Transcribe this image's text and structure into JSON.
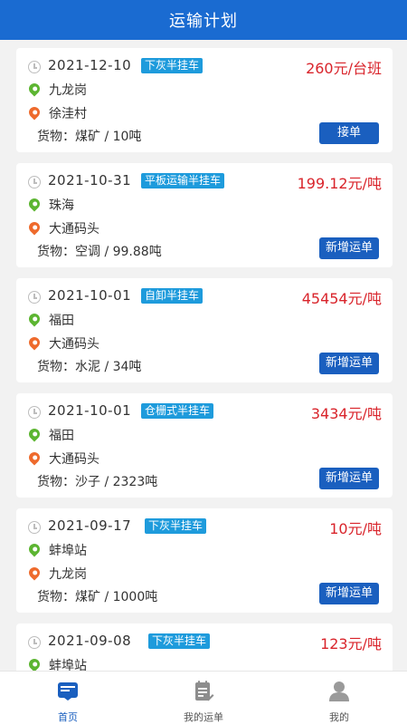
{
  "header": {
    "title": "运输计划"
  },
  "orders": [
    {
      "date": "2021-12-10",
      "vehicle_type": "下灰半挂车",
      "price": "260元/台班",
      "origin": "九龙岗",
      "destination": "徐洼村",
      "cargo": "货物：煤矿 / 10吨",
      "action": "接单"
    },
    {
      "date": "2021-10-31",
      "vehicle_type": "平板运输半挂车",
      "price": "199.12元/吨",
      "origin": "珠海",
      "destination": "大通码头",
      "cargo": "货物：空调 / 99.88吨",
      "action": "新增运单"
    },
    {
      "date": "2021-10-01",
      "vehicle_type": "自卸半挂车",
      "price": "45454元/吨",
      "origin": "福田",
      "destination": "大通码头",
      "cargo": "货物：水泥 / 34吨",
      "action": "新增运单"
    },
    {
      "date": "2021-10-01",
      "vehicle_type": "仓栅式半挂车",
      "price": "3434元/吨",
      "origin": "福田",
      "destination": "大通码头",
      "cargo": "货物：沙子 / 2323吨",
      "action": "新增运单"
    },
    {
      "date": "2021-09-17",
      "vehicle_type": "下灰半挂车",
      "price": "10元/吨",
      "origin": "蚌埠站",
      "destination": "九龙岗",
      "cargo": "货物：煤矿 / 1000吨",
      "action": "新增运单"
    },
    {
      "date": "2021-09-08",
      "vehicle_type": "下灰半挂车",
      "price": "123元/吨",
      "origin": "蚌埠站",
      "destination": "",
      "cargo": "",
      "action": ""
    }
  ],
  "tabbar": {
    "home": "首页",
    "my_orders": "我的运单",
    "me": "我的"
  },
  "colors": {
    "primary": "#1a6bd1",
    "price": "#d9242b",
    "tag": "#1e9bdc",
    "origin_pin": "#5cb531",
    "destination_pin": "#ee6a2c"
  },
  "icons": {
    "time": "clock-icon",
    "origin": "location-pin-green-icon",
    "destination": "location-pin-orange-icon",
    "home": "home-tab-icon",
    "my_orders": "clipboard-icon",
    "me": "user-icon"
  }
}
